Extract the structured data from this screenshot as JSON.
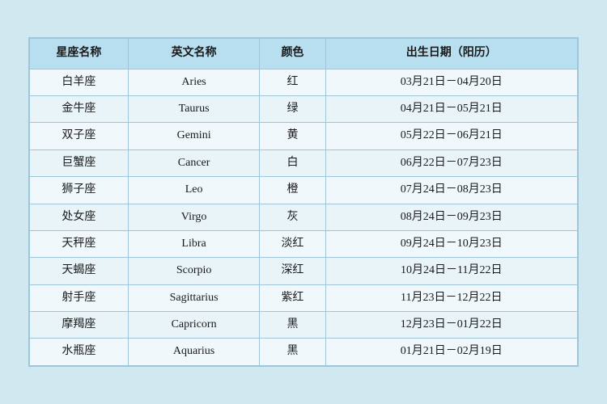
{
  "table": {
    "headers": [
      "星座名称",
      "英文名称",
      "颜色",
      "出生日期（阳历）"
    ],
    "rows": [
      {
        "cn": "白羊座",
        "en": "Aries",
        "color": "红",
        "date": "03月21日－04月20日"
      },
      {
        "cn": "金牛座",
        "en": "Taurus",
        "color": "绿",
        "date": "04月21日－05月21日"
      },
      {
        "cn": "双子座",
        "en": "Gemini",
        "color": "黄",
        "date": "05月22日－06月21日"
      },
      {
        "cn": "巨蟹座",
        "en": "Cancer",
        "color": "白",
        "date": "06月22日－07月23日"
      },
      {
        "cn": "狮子座",
        "en": "Leo",
        "color": "橙",
        "date": "07月24日－08月23日"
      },
      {
        "cn": "处女座",
        "en": "Virgo",
        "color": "灰",
        "date": "08月24日－09月23日"
      },
      {
        "cn": "天秤座",
        "en": "Libra",
        "color": "淡红",
        "date": "09月24日－10月23日"
      },
      {
        "cn": "天蝎座",
        "en": "Scorpio",
        "color": "深红",
        "date": "10月24日－11月22日"
      },
      {
        "cn": "射手座",
        "en": "Sagittarius",
        "color": "紫红",
        "date": "11月23日－12月22日"
      },
      {
        "cn": "摩羯座",
        "en": "Capricorn",
        "color": "黑",
        "date": "12月23日－01月22日"
      },
      {
        "cn": "水瓶座",
        "en": "Aquarius",
        "color": "黑",
        "date": "01月21日－02月19日"
      }
    ]
  }
}
